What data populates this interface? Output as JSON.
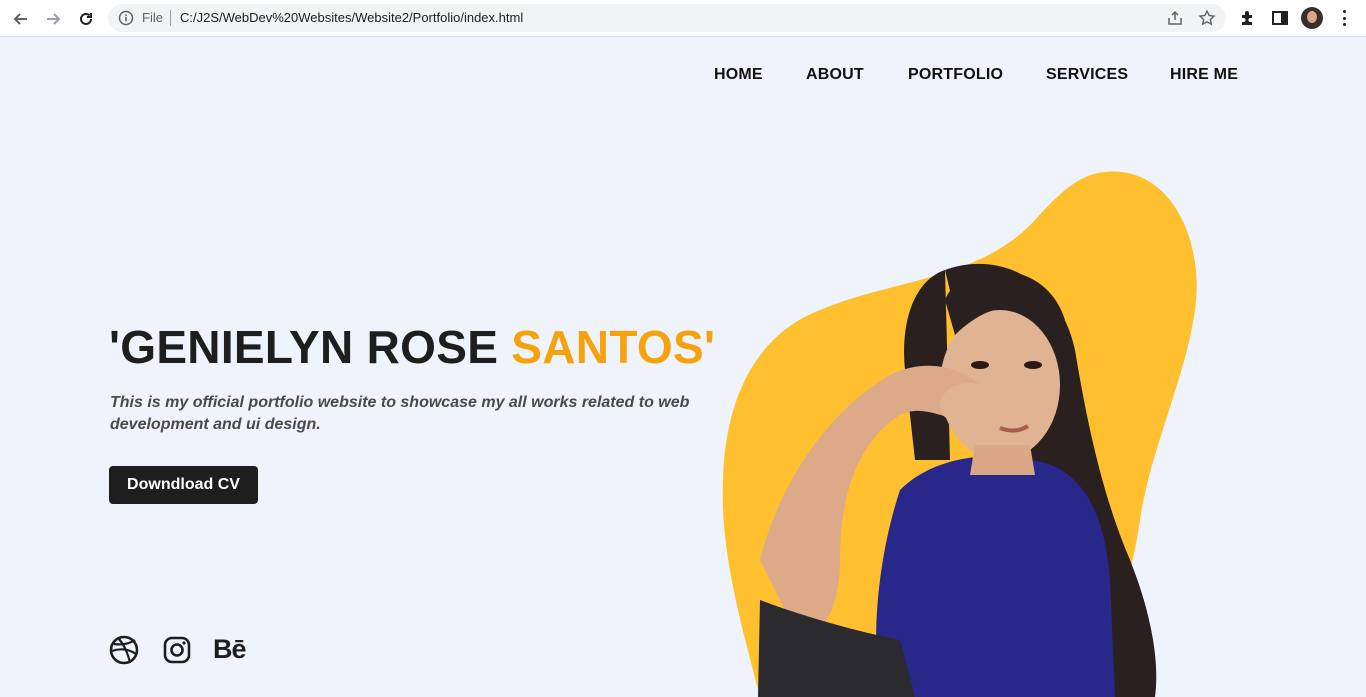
{
  "browser": {
    "file_label": "File",
    "url": "C:/J2S/WebDev%20Websites/Website2/Portfolio/index.html",
    "icons": [
      "back-arrow-icon",
      "forward-arrow-icon",
      "reload-icon",
      "info-icon",
      "share-icon",
      "star-icon",
      "extensions-icon",
      "side-panel-icon",
      "profile-avatar",
      "more-menu-icon"
    ]
  },
  "nav": {
    "items": [
      {
        "label": "HOME"
      },
      {
        "label": "ABOUT"
      },
      {
        "label": "PORTFOLIO"
      },
      {
        "label": "SERVICES"
      },
      {
        "label": "HIRE ME"
      }
    ]
  },
  "hero": {
    "title_main": "'GENIELYN ROSE ",
    "title_accent": "SANTOS'",
    "description": "This is my official portfolio website to showcase my all works related to web development and ui design.",
    "button_label": "Downdload CV",
    "accent_color": "#f5a20d",
    "blob_color": "#ffc030"
  },
  "social": {
    "icons": [
      "dribbble-icon",
      "instagram-icon",
      "behance-icon"
    ],
    "behance_text": "Bē"
  }
}
